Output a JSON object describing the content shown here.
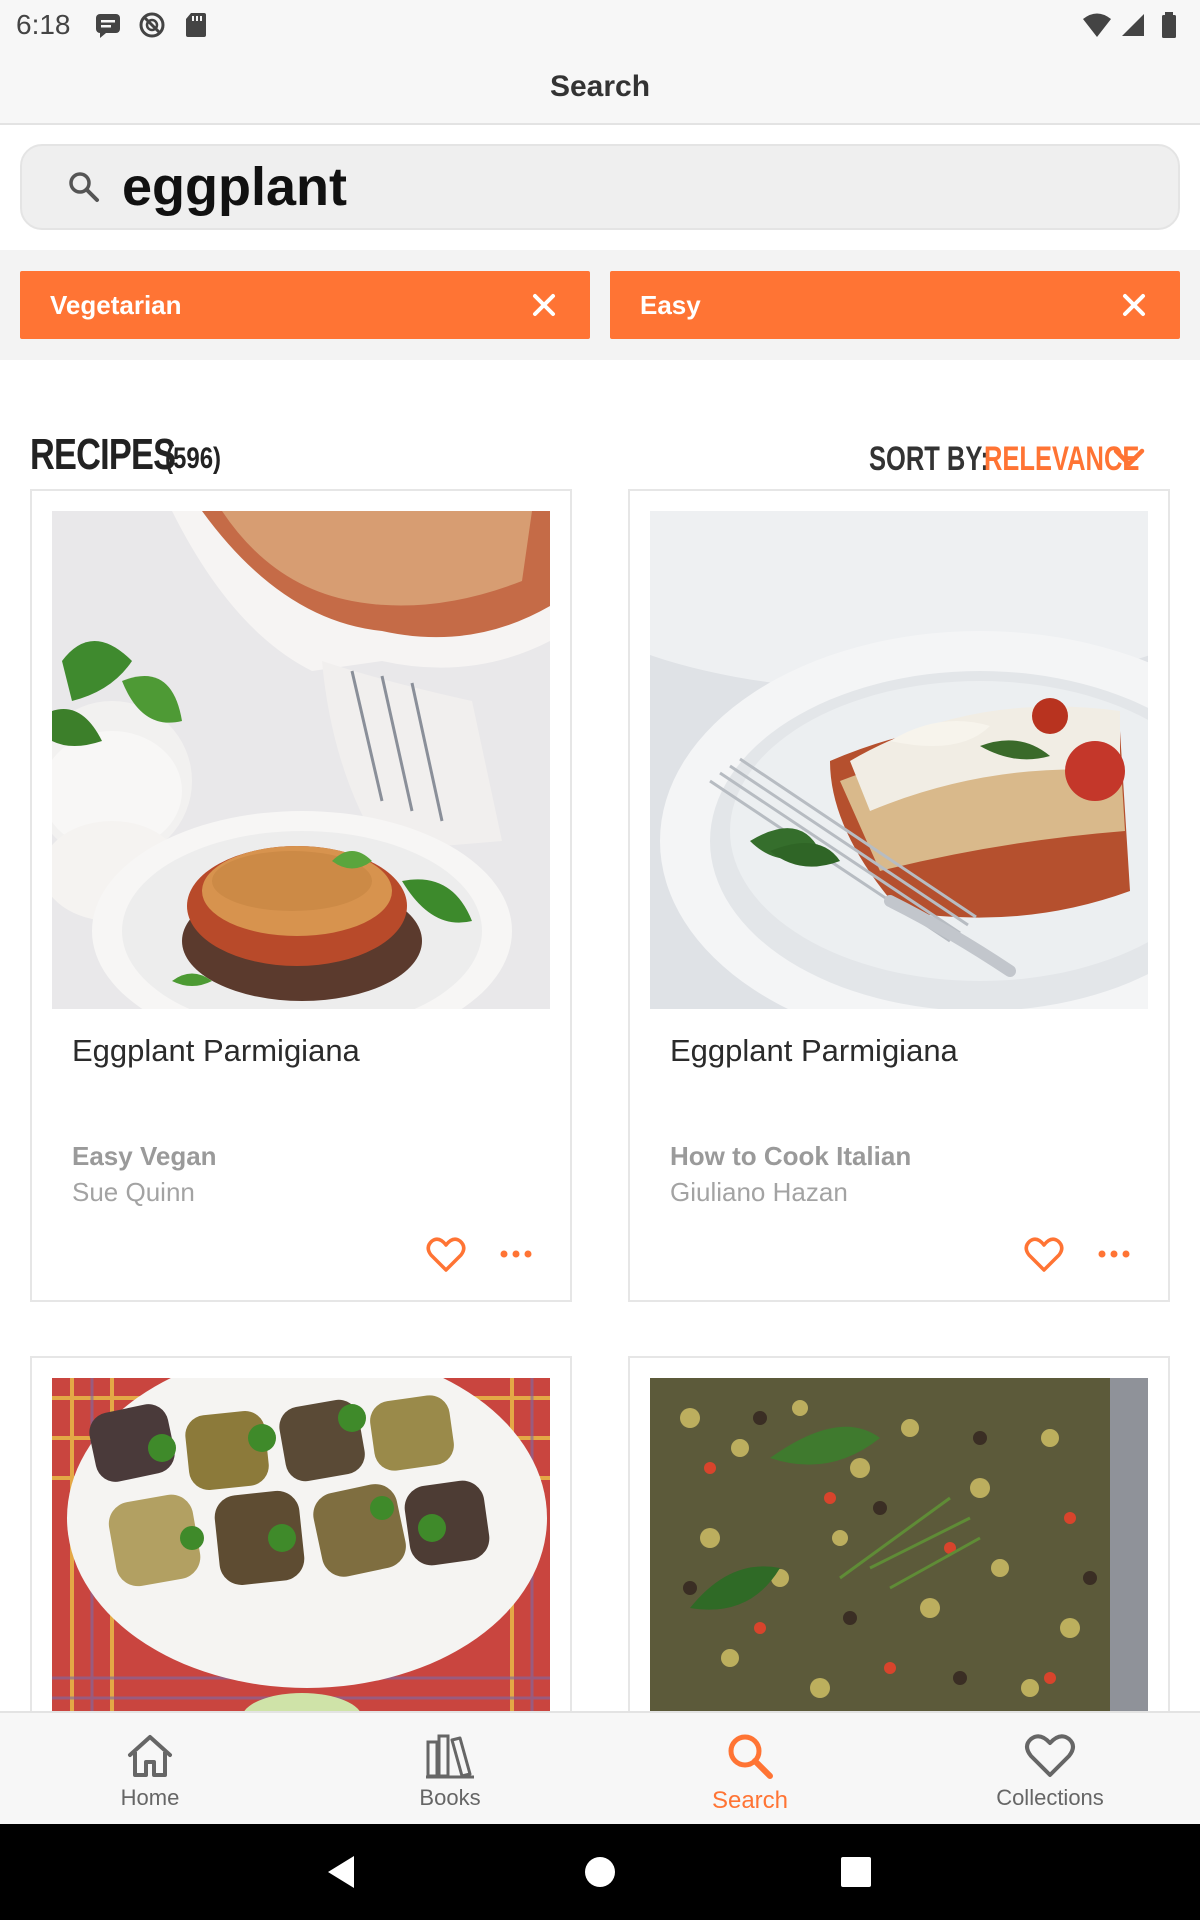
{
  "status_bar": {
    "time": "6:18",
    "left_icons": [
      "message-icon",
      "sync-icon",
      "sd-card-icon"
    ],
    "right_icons": [
      "wifi-icon",
      "signal-icon",
      "battery-icon"
    ]
  },
  "header": {
    "title": "Search"
  },
  "search": {
    "query": "eggplant",
    "icon": "search-icon"
  },
  "filters": [
    {
      "label": "Vegetarian"
    },
    {
      "label": "Easy"
    }
  ],
  "results": {
    "title": "RECIPES",
    "count": "(596)",
    "sort_label": "SORT BY:",
    "sort_value": "RELEVANCE"
  },
  "recipes": [
    {
      "title": "Eggplant Parmigiana",
      "book": "Easy Vegan",
      "author": "Sue Quinn"
    },
    {
      "title": "Eggplant Parmigiana",
      "book": "How to Cook Italian",
      "author": "Giuliano Hazan"
    },
    {
      "title": "",
      "book": "",
      "author": ""
    },
    {
      "title": "",
      "book": "",
      "author": ""
    }
  ],
  "bottom_nav": {
    "items": [
      {
        "label": "Home",
        "icon": "home-icon",
        "active": false
      },
      {
        "label": "Books",
        "icon": "books-icon",
        "active": false
      },
      {
        "label": "Search",
        "icon": "search-icon",
        "active": true
      },
      {
        "label": "Collections",
        "icon": "heart-icon",
        "active": false
      }
    ]
  },
  "colors": {
    "accent": "#ff7434",
    "background": "#ffffff",
    "bar_background": "#f7f7f7",
    "system_nav": "#000000"
  }
}
